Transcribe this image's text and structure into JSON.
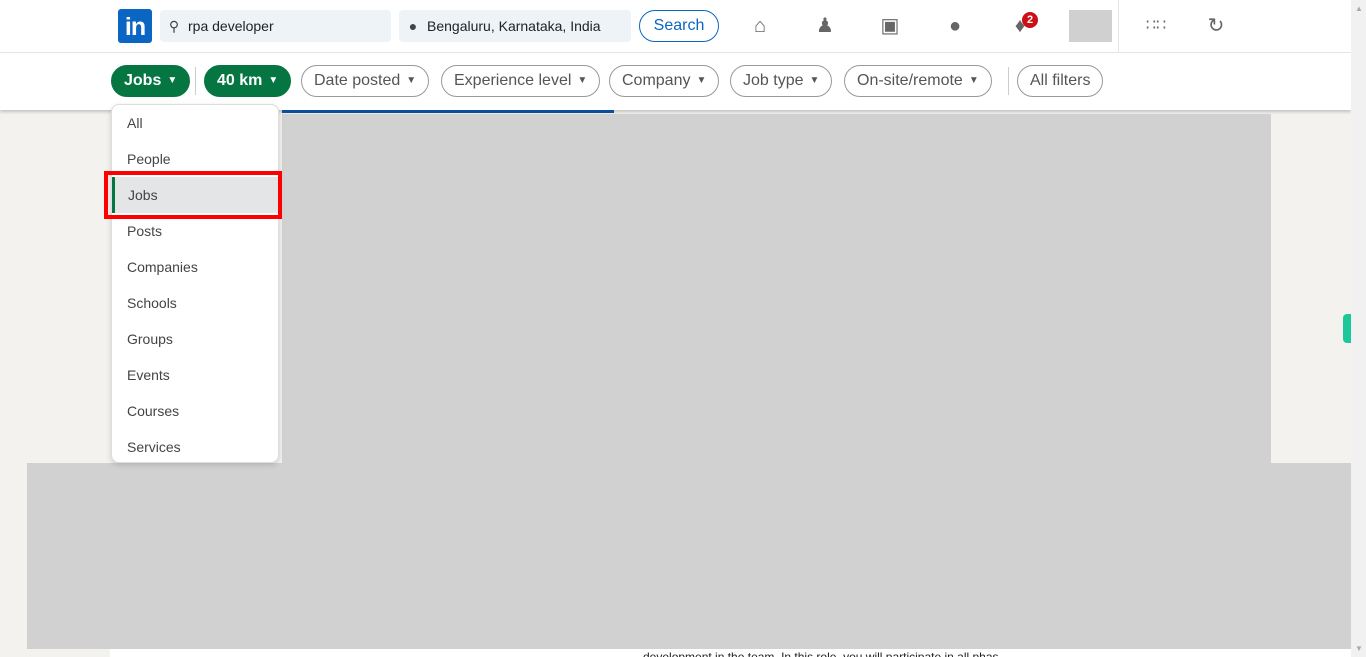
{
  "header": {
    "logo": "in",
    "search_value": "rpa developer",
    "location_value": "Bengaluru, Karnataka, India",
    "search_button": "Search",
    "notification_count": "2",
    "nav_icons": [
      "home-icon",
      "my-network-icon",
      "jobs-icon",
      "messaging-icon",
      "notifications-icon",
      "apps-grid-icon",
      "advertise-icon"
    ]
  },
  "filters": {
    "items": [
      {
        "label": "Jobs",
        "active": true
      },
      {
        "label": "40 km",
        "active": true
      },
      {
        "label": "Date posted"
      },
      {
        "label": "Experience level"
      },
      {
        "label": "Company"
      },
      {
        "label": "Job type"
      },
      {
        "label": "On-site/remote"
      }
    ],
    "all_filters": "All filters"
  },
  "dropdown": {
    "items": [
      "All",
      "People",
      "Jobs",
      "Posts",
      "Companies",
      "Schools",
      "Groups",
      "Events",
      "Courses",
      "Services"
    ],
    "selected": "Jobs"
  },
  "body": {
    "partial_text": "development in the team. In this role, you will participate in all phas"
  },
  "colors": {
    "brand": "#0a66c2",
    "active_filter": "#057642",
    "highlight": "#ff0000",
    "badge": "#cc1016"
  }
}
